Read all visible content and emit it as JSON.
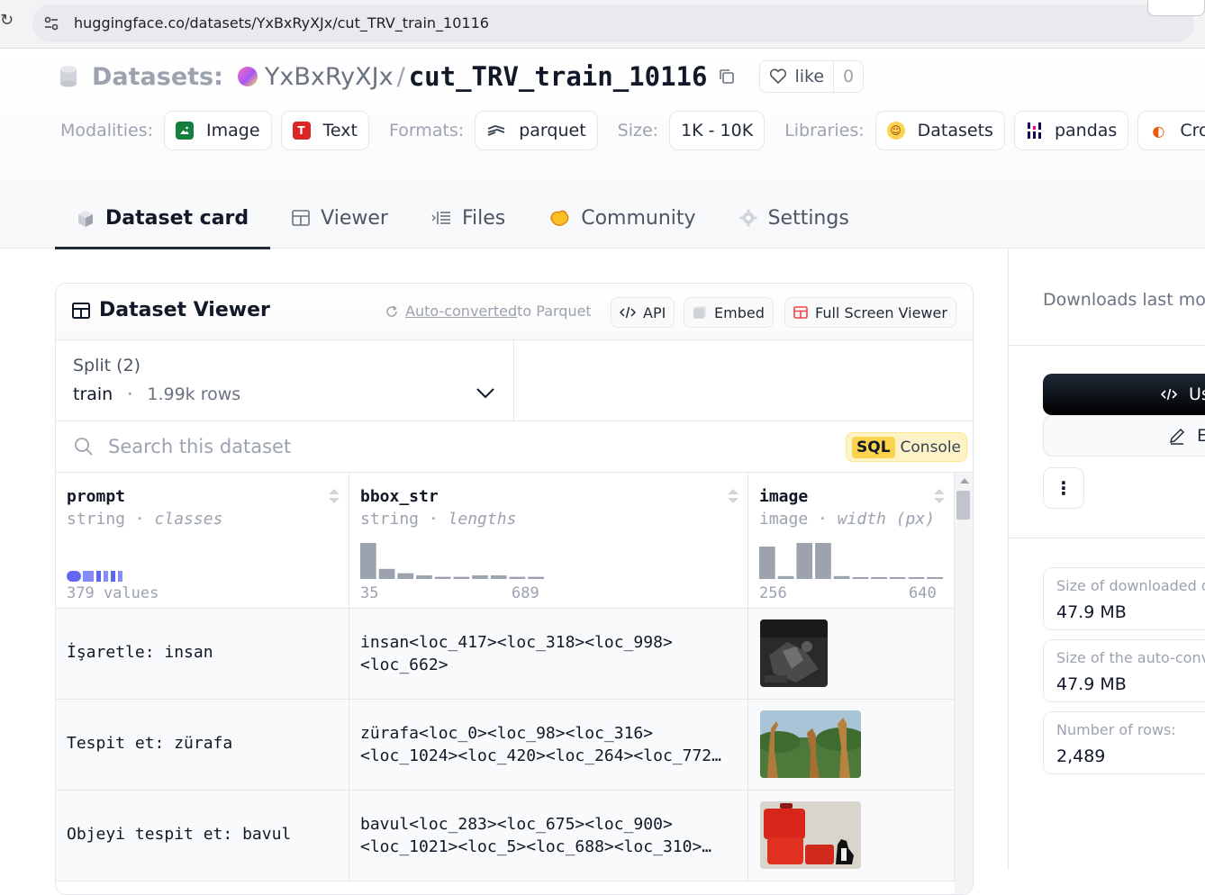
{
  "browser": {
    "url": "huggingface.co/datasets/YxBxRyXJx/cut_TRV_train_10116"
  },
  "header": {
    "datasets_label": "Datasets:",
    "owner": "YxBxRyXJx",
    "separator": "/",
    "repo_name": "cut_TRV_train_10116",
    "like_label": "like",
    "like_count": "0"
  },
  "tags": {
    "modalities_label": "Modalities:",
    "modalities": [
      "Image",
      "Text"
    ],
    "formats_label": "Formats:",
    "format": "parquet",
    "size_label": "Size:",
    "size": "1K - 10K",
    "libraries_label": "Libraries:",
    "libraries": [
      "Datasets",
      "pandas",
      "Croiss"
    ]
  },
  "tabs": [
    {
      "label": "Dataset card",
      "active": true
    },
    {
      "label": "Viewer",
      "active": false
    },
    {
      "label": "Files",
      "active": false
    },
    {
      "label": "Community",
      "active": false
    },
    {
      "label": "Settings",
      "active": false
    }
  ],
  "viewer": {
    "title": "Dataset Viewer",
    "auto_converted_link": "Auto-converted",
    "auto_converted_rest": " to Parquet",
    "api_label": "API",
    "embed_label": "Embed",
    "fullscreen_label": "Full Screen Viewer",
    "split_label": "Split (2)",
    "split_name": "train",
    "split_dot": "·",
    "split_rows": "1.99k rows",
    "search_placeholder": "Search this dataset",
    "sql_badge": "SQL",
    "sql_label": "Console",
    "columns": [
      {
        "name": "prompt",
        "type": "string",
        "stat": "classes",
        "summary": "379 values"
      },
      {
        "name": "bbox_str",
        "type": "string",
        "stat": "lengths",
        "min": "35",
        "max": "689",
        "histogram": [
          1.0,
          0.28,
          0.16,
          0.1,
          0.06,
          0.06,
          0.1,
          0.1,
          0.06,
          0.06
        ]
      },
      {
        "name": "image",
        "type": "image",
        "stat": "width (px)",
        "min": "256",
        "max": "640",
        "histogram": [
          0.9,
          0.08,
          1.0,
          1.0,
          0.08,
          0.05,
          0.05,
          0.05,
          0.05,
          0.05
        ]
      }
    ],
    "rows": [
      {
        "prompt": "İşaretle: insan",
        "bbox_str": "insan<loc_417><loc_318><loc_998>\n<loc_662>",
        "image": "dark-scene-thumbnail"
      },
      {
        "prompt": "Tespit et: zürafa",
        "bbox_str": "zürafa<loc_0><loc_98><loc_316>\n<loc_1024><loc_420><loc_264><loc_772…",
        "image": "giraffes-thumbnail"
      },
      {
        "prompt": "Objeyi tespit et: bavul",
        "bbox_str": "bavul<loc_283><loc_675><loc_900>\n<loc_1021><loc_5><loc_688><loc_310>…",
        "image": "suitcases-cat-thumbnail"
      }
    ]
  },
  "right_panel": {
    "downloads_label": "Downloads last mor",
    "use_label": "Us",
    "edit_label": "E",
    "more_label": "⋮",
    "stats": [
      {
        "label": "Size of downloaded d",
        "value": "47.9 MB"
      },
      {
        "label": "Size of the auto-conve",
        "value": "47.9 MB"
      },
      {
        "label": "Number of rows:",
        "value": "2,489"
      }
    ]
  },
  "colors": {
    "accent_tab_underline": "#1f2937",
    "sql_badge": "#fcd34d",
    "classes_bar": "#6366f1",
    "histogram_bar": "#9ca3af"
  }
}
